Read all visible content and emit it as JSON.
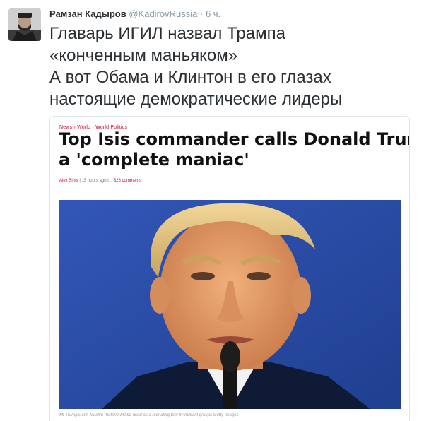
{
  "tweet": {
    "author_name": "Рамзан Кадыров",
    "handle": "@KadirovRussia",
    "separator": "·",
    "time": "6 ч.",
    "text_lines": [
      "Главарь ИГИЛ назвал Трампа",
      "«конченным маньяком»",
      "А вот Обама и Клинтон в его глазах",
      "настоящие демократические лидеры"
    ]
  },
  "article": {
    "breadcrumb": "News › World › World Politics",
    "headline_lines": [
      "Top Isis commander calls Donald Trump",
      "a 'complete maniac'"
    ],
    "author": "Alex Sims",
    "time_ago": "15 hours ago",
    "comments": "328 comments",
    "caption": "Mr Trump's anti-Muslim rhetoric will be used as a recruiting tool by militant groups Getty Images"
  },
  "colors": {
    "name": "#292f33",
    "muted": "#8899a6",
    "accent_red": "#c8102e",
    "photo_bg": "#2d4fa8"
  }
}
